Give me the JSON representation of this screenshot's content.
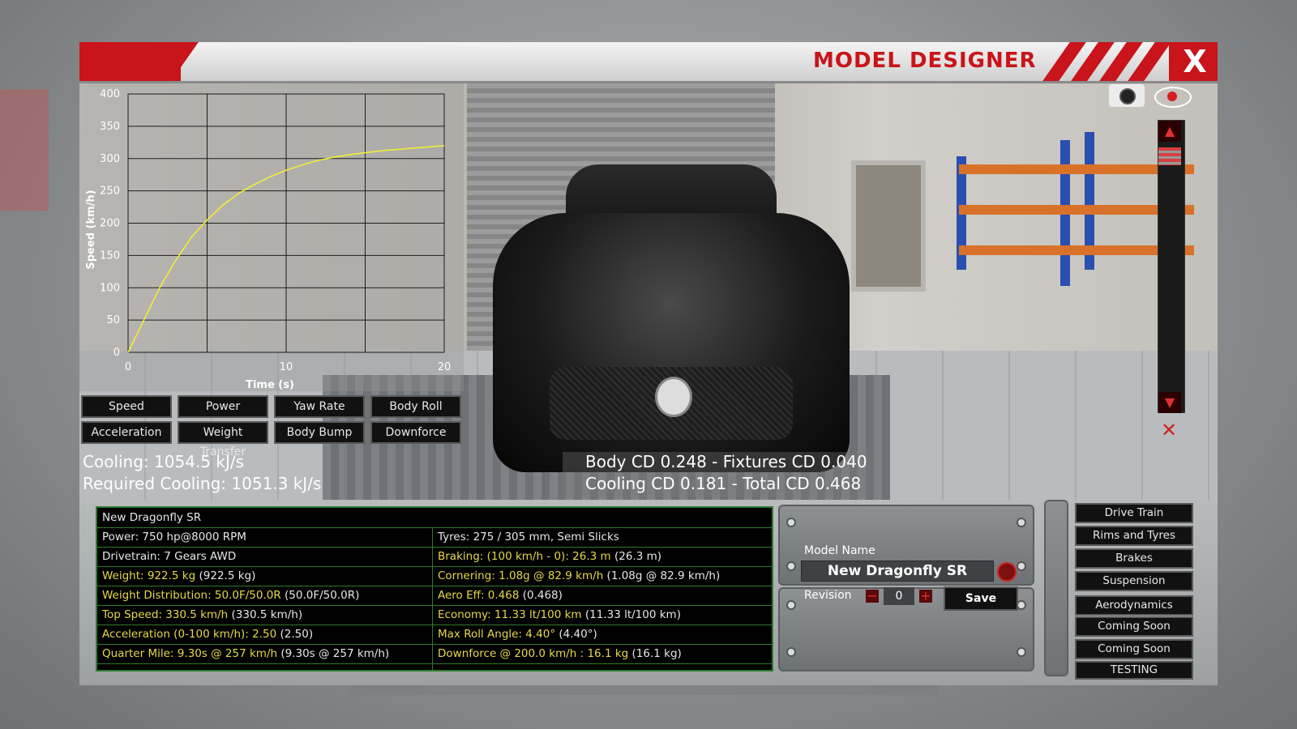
{
  "window": {
    "title": "MODEL DESIGNER",
    "close_label": "X"
  },
  "graph": {
    "buttons": [
      "Speed",
      "Power",
      "Yaw Rate",
      "Body Roll",
      "Acceleration",
      "Weight Transfer",
      "Body Bump",
      "Downforce"
    ]
  },
  "chart_data": {
    "type": "line",
    "xlabel": "Time (s)",
    "ylabel": "Speed (km/h)",
    "xlim": [
      0,
      20
    ],
    "ylim": [
      0,
      400
    ],
    "x_ticks": [
      "0",
      "10",
      "20"
    ],
    "y_ticks": [
      "0",
      "50",
      "100",
      "150",
      "200",
      "250",
      "300",
      "350",
      "400"
    ],
    "grid": true,
    "series": [
      {
        "color": "#f2ee36",
        "x": [
          0,
          1,
          2,
          3,
          4,
          5,
          6,
          7,
          8,
          9,
          10,
          11,
          12,
          13,
          14,
          15,
          16,
          17,
          18,
          19,
          20
        ],
        "y": [
          0,
          50,
          100,
          142,
          178,
          205,
          228,
          246,
          260,
          272,
          282,
          290,
          297,
          302,
          306,
          309,
          312,
          314,
          316,
          318,
          320
        ]
      }
    ]
  },
  "stats": {
    "cooling": "Cooling: 1054.5 kJ/s",
    "required_cooling": "Required Cooling: 1051.3 kJ/s",
    "drag_line1": "Body CD 0.248 - Fixtures CD 0.040",
    "drag_line2": "Cooling CD 0.181 - Total CD 0.468"
  },
  "info": {
    "name": "New Dragonfly SR",
    "left": [
      {
        "text": "Power: 750 hp@8000 RPM",
        "hl": ""
      },
      {
        "text": "Drivetrain: 7 Gears AWD",
        "hl": ""
      },
      {
        "text": "",
        "hl": "Weight: 922.5 kg",
        "rest": " (922.5 kg)"
      },
      {
        "text": "",
        "hl": "Weight Distribution: 50.0F/50.0R",
        "rest": " (50.0F/50.0R)"
      },
      {
        "text": "",
        "hl": "Top Speed: 330.5 km/h",
        "rest": " (330.5 km/h)"
      },
      {
        "text": "",
        "hl": "Acceleration (0-100 km/h): 2.50",
        "rest": " (2.50)"
      },
      {
        "text": "",
        "hl": "Quarter Mile: 9.30s @ 257 km/h",
        "rest": " (9.30s @ 257 km/h)"
      }
    ],
    "right": [
      {
        "text": "Tyres: 275 / 305 mm, Semi Slicks",
        "hl": ""
      },
      {
        "text": "",
        "hl": "Braking: (100 km/h - 0): 26.3 m",
        "rest": " (26.3 m)"
      },
      {
        "text": "",
        "hl": "Cornering: 1.08g @ 82.9 km/h",
        "rest": " (1.08g @ 82.9 km/h)"
      },
      {
        "text": "",
        "hl": "Aero Eff: 0.468",
        "rest": " (0.468)"
      },
      {
        "text": "",
        "hl": "Economy: 11.33 lt/100 km",
        "rest": " (11.33 lt/100 km)"
      },
      {
        "text": "",
        "hl": "Max Roll Angle: 4.40°",
        "rest": " (4.40°)"
      },
      {
        "text": "",
        "hl": "Downforce @ 200.0 km/h : 16.1 kg",
        "rest": " (16.1 kg)"
      }
    ]
  },
  "model": {
    "name_label": "Model Name",
    "name_value": "New Dragonfly SR",
    "revision_label": "Revision",
    "revision_value": "0",
    "minus": "−",
    "plus": "+",
    "save_label": "Save"
  },
  "side_menu": [
    "Drive Train",
    "Rims and Tyres",
    "Brakes",
    "Suspension",
    "Aerodynamics",
    "Coming Soon",
    "Coming Soon",
    "TESTING"
  ],
  "icons": {
    "camera": "camera-icon",
    "eye": "eye-icon",
    "hide": "hide-icon",
    "refresh": "refresh-icon"
  },
  "colors": {
    "accent": "#c8141a",
    "highlight": "#e6d94a",
    "table_border": "#2f7a2f",
    "curve": "#f2ee36"
  }
}
